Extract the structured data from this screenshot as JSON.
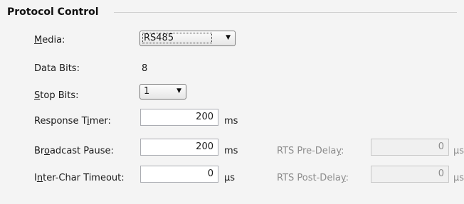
{
  "group": {
    "title": "Protocol Control"
  },
  "media": {
    "label_pre": "",
    "label_key": "M",
    "label_post": "edia:",
    "value": "RS485"
  },
  "data_bits": {
    "label": "Data Bits:",
    "value": "8"
  },
  "stop_bits": {
    "label_pre": "",
    "label_key": "S",
    "label_post": "top Bits:",
    "value": "1"
  },
  "response_timer": {
    "label_pre": "Response T",
    "label_key": "i",
    "label_post": "mer:",
    "value": "200",
    "unit": "ms"
  },
  "broadcast_pause": {
    "label_pre": "Br",
    "label_key": "o",
    "label_post": "adcast Pause:",
    "value": "200",
    "unit": "ms"
  },
  "inter_char_timeout": {
    "label_pre": "I",
    "label_key": "n",
    "label_post": "ter-Char Timeout:",
    "value": "0",
    "unit": "µs"
  },
  "rts_pre_delay": {
    "label_pre": "RTS Pre-Dela",
    "label_key": "y",
    "label_post": ":",
    "value": "0",
    "unit": "µs"
  },
  "rts_post_delay": {
    "label_pre": "RTS Post-Dela",
    "label_key": "y",
    "label_post": ":",
    "value": "0",
    "unit": "µs"
  }
}
